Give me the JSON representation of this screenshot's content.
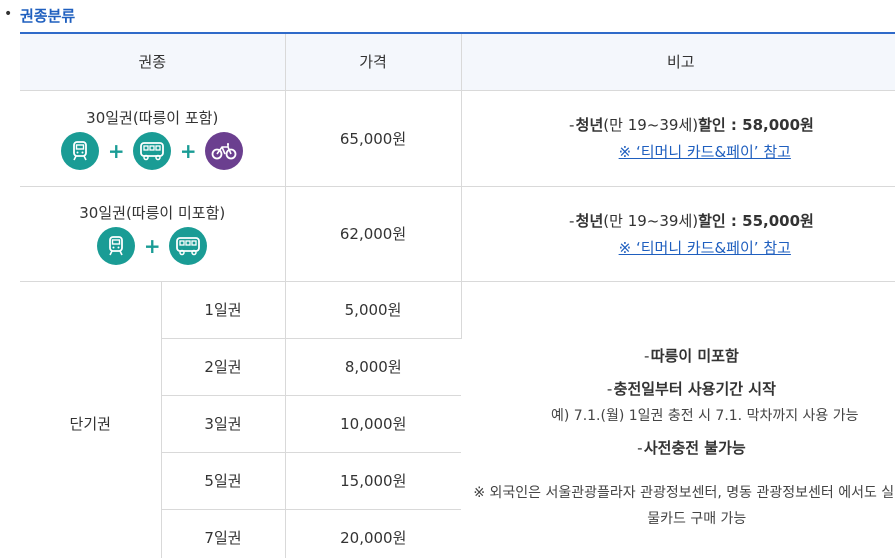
{
  "section": {
    "bullet": "•",
    "title": "권종분류"
  },
  "table": {
    "headers": [
      "권종",
      "가격",
      "비고"
    ],
    "pass30_with": {
      "name": "30일권(따릉이 포함)",
      "price": "65,000원",
      "icons": [
        "subway-icon",
        "bus-icon",
        "bicycle-icon"
      ],
      "note_prefix": "청년",
      "note_mid": "(만 19~39세)",
      "note_suffix": "할인 : 58,000원",
      "link": "※ ‘티머니 카드&페이’ 참고"
    },
    "pass30_without": {
      "name": "30일권(따릉이 미포함)",
      "price": "62,000원",
      "icons": [
        "subway-icon",
        "bus-icon"
      ],
      "note_prefix": "청년",
      "note_mid": "(만 19~39세)",
      "note_suffix": "할인 : 55,000원",
      "link": "※ ‘티머니 카드&페이’ 참고"
    },
    "short_term": {
      "category": "단기권",
      "rows": [
        {
          "days": "1일권",
          "price": "5,000원"
        },
        {
          "days": "2일권",
          "price": "8,000원"
        },
        {
          "days": "3일권",
          "price": "10,000원"
        },
        {
          "days": "5일권",
          "price": "15,000원"
        },
        {
          "days": "7일권",
          "price": "20,000원"
        }
      ],
      "notes": {
        "line1": "따릉이 미포함",
        "line2": "충전일부터 사용기간 시작",
        "line2_example": "예) 7.1.(월) 1일권 충전 시 7.1. 막차까지 사용 가능",
        "line3": "사전충전 불가능",
        "footnote": "※  외국인은 서울관광플라자 관광정보센터, 명동 관광정보센터 에서도 실물카드 구매 가능"
      }
    },
    "plus_sign": "+",
    "dash": "-"
  },
  "colors": {
    "accent_blue": "#1f5fbf",
    "icon_teal": "#1a9c95",
    "icon_purple": "#6b3f8f",
    "header_bg": "#f4f7fc"
  }
}
